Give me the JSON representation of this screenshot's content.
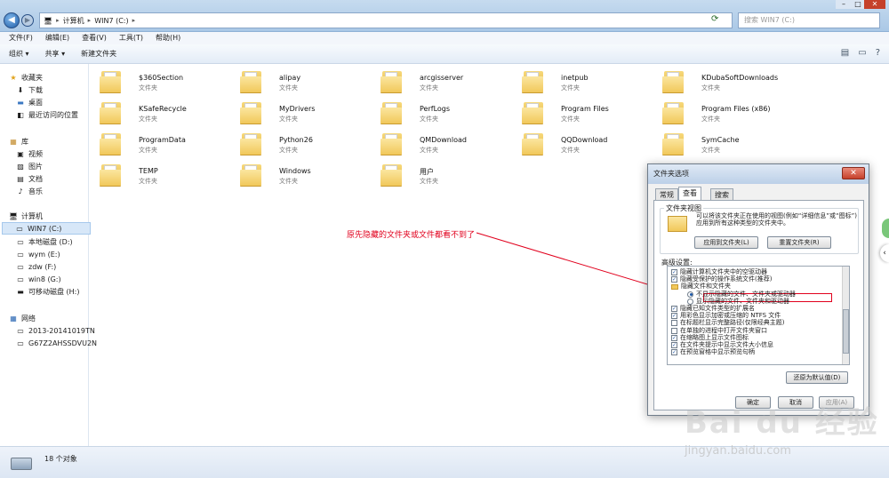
{
  "window": {
    "address": [
      "计算机",
      "WIN7 (C:)"
    ],
    "search_placeholder": "搜索 WIN7 (C:)",
    "controls": [
      "–",
      "□",
      "✕"
    ]
  },
  "menu": [
    "文件(F)",
    "编辑(E)",
    "查看(V)",
    "工具(T)",
    "帮助(H)"
  ],
  "toolbar": {
    "organize": "组织 ▾",
    "share": "共享 ▾",
    "new_folder": "新建文件夹"
  },
  "sidebar": {
    "favorites": "收藏夹",
    "fav_items": [
      "下载",
      "桌面",
      "最近访问的位置"
    ],
    "library": "库",
    "lib_items": [
      "视频",
      "图片",
      "文档",
      "音乐"
    ],
    "computer": "计算机",
    "drives": [
      "WIN7 (C:)",
      "本地磁盘 (D:)",
      "wym (E:)",
      "zdw (F:)",
      "win8 (G:)",
      "可移动磁盘 (H:)"
    ],
    "network": "网络",
    "net_items": [
      "2013-20141019TN",
      "G67Z2AHSSDVU2N"
    ]
  },
  "files": [
    {
      "name": "$360Section",
      "type": "文件夹"
    },
    {
      "name": "alipay",
      "type": "文件夹"
    },
    {
      "name": "arcgisserver",
      "type": "文件夹"
    },
    {
      "name": "inetpub",
      "type": "文件夹"
    },
    {
      "name": "KDubaSoftDownloads",
      "type": "文件夹"
    },
    {
      "name": "KSafeRecycle",
      "type": "文件夹"
    },
    {
      "name": "MyDrivers",
      "type": "文件夹"
    },
    {
      "name": "PerfLogs",
      "type": "文件夹"
    },
    {
      "name": "Program Files",
      "type": "文件夹"
    },
    {
      "name": "Program Files (x86)",
      "type": "文件夹"
    },
    {
      "name": "ProgramData",
      "type": "文件夹"
    },
    {
      "name": "Python26",
      "type": "文件夹"
    },
    {
      "name": "QMDownload",
      "type": "文件夹"
    },
    {
      "name": "QQDownload",
      "type": "文件夹"
    },
    {
      "name": "SymCache",
      "type": "文件夹"
    },
    {
      "name": "TEMP",
      "type": "文件夹"
    },
    {
      "name": "Windows",
      "type": "文件夹"
    },
    {
      "name": "用户",
      "type": "文件夹"
    }
  ],
  "status": {
    "count": "18 个对象"
  },
  "annotation": "原先隐藏的文件夹或文件都看不到了",
  "dialog": {
    "title": "文件夹选项",
    "tabs": [
      "常规",
      "查看",
      "搜索"
    ],
    "folder_view_title": "文件夹视图",
    "folder_view_desc": "可以将该文件夹正在使用的视图(例如“详细信息”或“图标”)应用到所有这种类型的文件夹中。",
    "apply_button": "应用到文件夹(L)",
    "reset_button": "重置文件夹(R)",
    "advanced_label": "高级设置:",
    "advanced_items": [
      {
        "kind": "check",
        "checked": true,
        "label": "隐藏计算机文件夹中的空驱动器"
      },
      {
        "kind": "check",
        "checked": true,
        "label": "隐藏受保护的操作系统文件(推荐)"
      },
      {
        "kind": "folder",
        "checked": false,
        "label": "隐藏文件和文件夹"
      },
      {
        "kind": "radio",
        "checked": true,
        "label": "不显示隐藏的文件、文件夹或驱动器"
      },
      {
        "kind": "radio",
        "checked": false,
        "label": "显示隐藏的文件、文件夹和驱动器"
      },
      {
        "kind": "check",
        "checked": true,
        "label": "隐藏已知文件类型的扩展名"
      },
      {
        "kind": "check",
        "checked": true,
        "label": "用彩色显示加密或压缩的 NTFS 文件"
      },
      {
        "kind": "check",
        "checked": false,
        "label": "在标题栏显示完整路径(仅限经典主题)"
      },
      {
        "kind": "check",
        "checked": false,
        "label": "在单独的进程中打开文件夹窗口"
      },
      {
        "kind": "check",
        "checked": true,
        "label": "在缩略图上显示文件图标"
      },
      {
        "kind": "check",
        "checked": true,
        "label": "在文件夹提示中显示文件大小信息"
      },
      {
        "kind": "check",
        "checked": true,
        "label": "在预览窗格中显示预览句柄"
      }
    ],
    "restore_button": "还原为默认值(D)",
    "ok": "确定",
    "cancel": "取消",
    "apply": "应用(A)"
  },
  "watermark": {
    "logo": "Bai du 经验",
    "url": "jingyan.baidu.com"
  }
}
